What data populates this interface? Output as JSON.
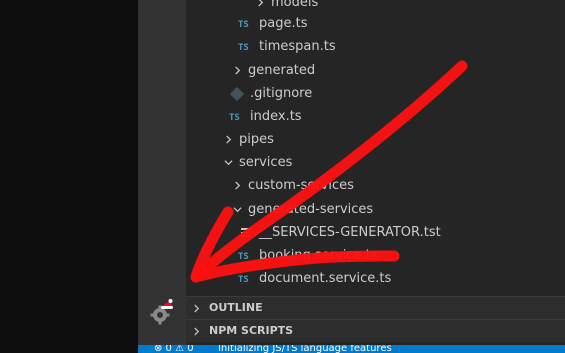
{
  "explorer": {
    "tree": [
      {
        "label": "models",
        "kind": "folder-collapsed"
      },
      {
        "label": "page.ts",
        "kind": "ts"
      },
      {
        "label": "timespan.ts",
        "kind": "ts"
      },
      {
        "label": "generated",
        "kind": "folder-collapsed"
      },
      {
        "label": ".gitignore",
        "kind": "git"
      },
      {
        "label": "index.ts",
        "kind": "ts"
      },
      {
        "label": "pipes",
        "kind": "folder-collapsed"
      },
      {
        "label": "services",
        "kind": "folder-expanded"
      },
      {
        "label": "custom-services",
        "kind": "folder-collapsed"
      },
      {
        "label": "generated-services",
        "kind": "folder-expanded"
      },
      {
        "label": "__SERVICES-GENERATOR.tst",
        "kind": "text"
      },
      {
        "label": "booking.service.ts",
        "kind": "ts"
      },
      {
        "label": "document.service.ts",
        "kind": "ts"
      }
    ],
    "ts_badge": "TS"
  },
  "panels": {
    "outline": "OUTLINE",
    "npm_scripts": "NPM SCRIPTS"
  },
  "status_bar": {
    "problems": "⊗ 0 ⚠ 0",
    "message": "Initializing JS/TS language features"
  },
  "colors": {
    "activity_bar": "#333333",
    "sidebar": "#252526",
    "status_bar": "#007acc",
    "ts_icon": "#519aba",
    "annotation": "#ff1010"
  },
  "icons": {
    "activity": "settings-gear-icon",
    "chevron": "chevron-icon"
  }
}
